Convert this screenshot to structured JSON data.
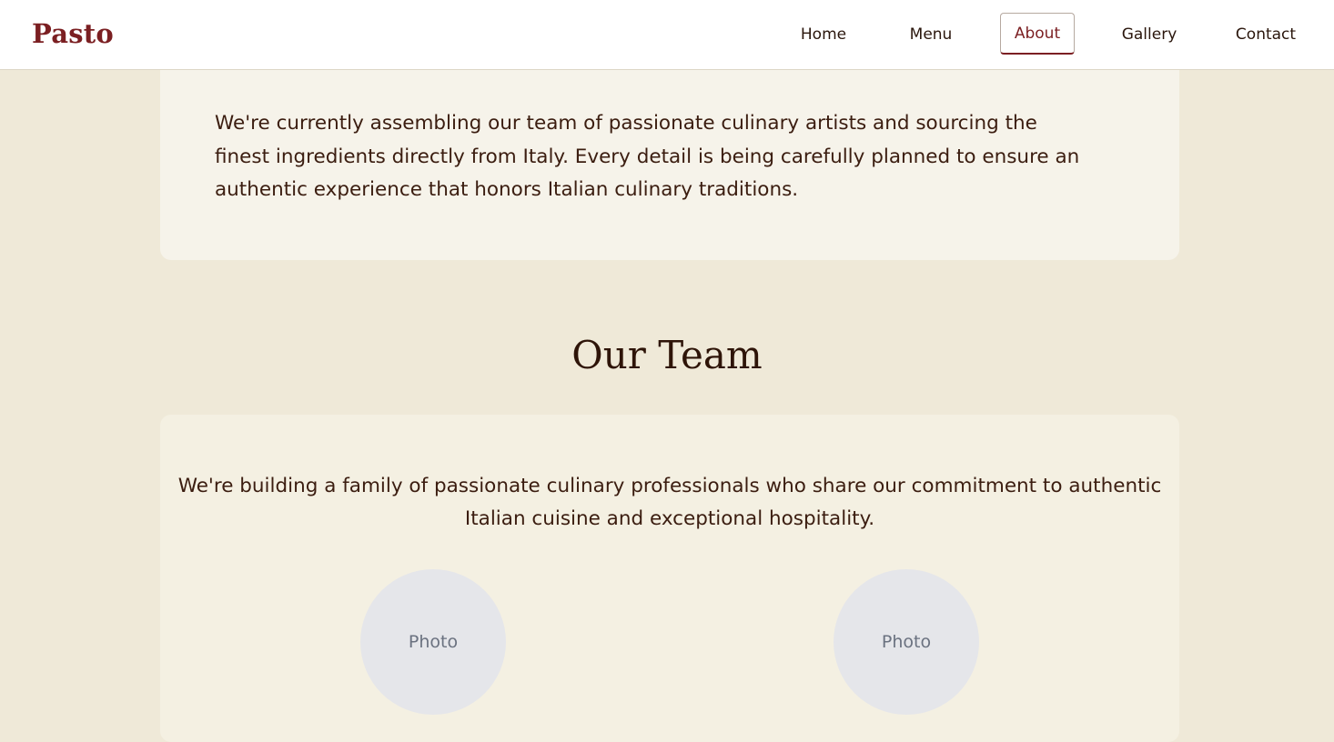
{
  "header": {
    "logo": "Pasto",
    "nav": [
      {
        "label": "Home"
      },
      {
        "label": "Menu"
      },
      {
        "label": "About"
      },
      {
        "label": "Gallery"
      },
      {
        "label": "Contact"
      }
    ],
    "active_nav": "About"
  },
  "intro": {
    "text": "We're currently assembling our team of passionate culinary artists and sourcing the finest ingredients directly from Italy. Every detail is being carefully planned to ensure an authentic experience that honors Italian culinary traditions."
  },
  "team": {
    "title": "Our Team",
    "text": "We're building a family of passionate culinary professionals who share our commitment to authentic Italian cuisine and exceptional hospitality.",
    "members": [
      {
        "photo_label": "Photo"
      },
      {
        "photo_label": "Photo"
      }
    ]
  },
  "colors": {
    "brand": "#7b1f22",
    "page_background": "#efe9d8",
    "card_background": "#f6f3ea",
    "text": "#3b1d10",
    "photo_placeholder": "#e5e6ea"
  }
}
